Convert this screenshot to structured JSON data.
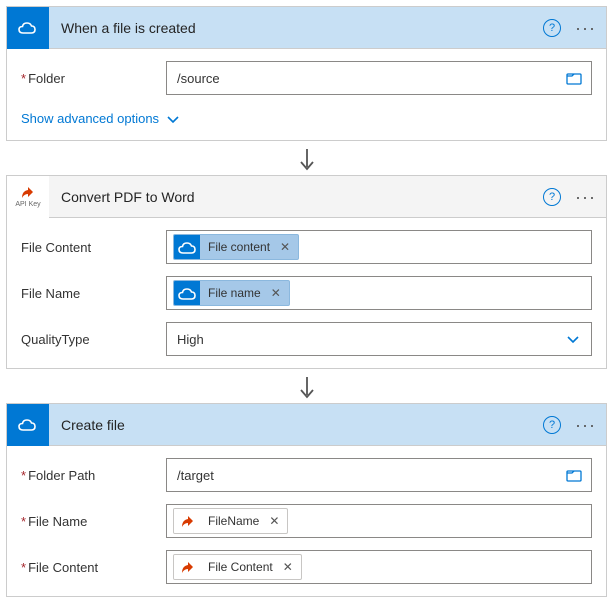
{
  "step1": {
    "title": "When a file is created",
    "folderLabel": "Folder",
    "folderValue": "/source",
    "advanced": "Show advanced options"
  },
  "step2": {
    "title": "Convert PDF to Word",
    "fileContentLabel": "File Content",
    "fileContentToken": "File content",
    "fileNameLabel": "File Name",
    "fileNameToken": "File name",
    "qualityLabel": "QualityType",
    "qualityValue": "High",
    "apiKeyLabel": "API Key"
  },
  "step3": {
    "title": "Create file",
    "folderPathLabel": "Folder Path",
    "folderPathValue": "/target",
    "fileNameLabel": "File Name",
    "fileNameToken": "FileName",
    "fileContentLabel": "File Content",
    "fileContentToken": "File Content"
  }
}
